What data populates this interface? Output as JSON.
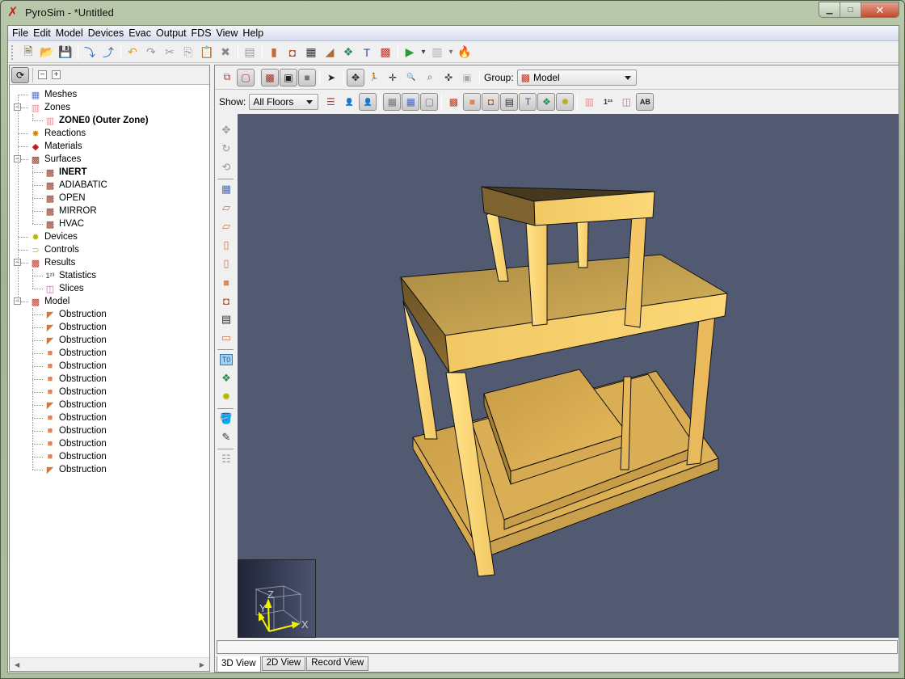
{
  "window": {
    "title": "PyroSim - *Untitled",
    "app_icon": "pyrosim-logo-icon",
    "controls": {
      "minimize": "▁",
      "maximize": "□",
      "close": "✕"
    }
  },
  "menubar": [
    "File",
    "Edit",
    "Model",
    "Devices",
    "Evac",
    "Output",
    "FDS",
    "View",
    "Help"
  ],
  "main_toolbar": [
    {
      "name": "new-file-icon",
      "glyph": "🗎",
      "color": "#6d5b2c"
    },
    {
      "name": "open-folder-icon",
      "glyph": "📂",
      "color": "#d79b2d"
    },
    {
      "name": "save-icon",
      "glyph": "💾",
      "color": "#5b7db6"
    },
    {
      "sep": true
    },
    {
      "name": "import-icon",
      "glyph": "⤵",
      "color": "#2b6dbf"
    },
    {
      "name": "export-icon",
      "glyph": "⤴",
      "color": "#2b6dbf"
    },
    {
      "sep": true
    },
    {
      "name": "undo-icon",
      "glyph": "↶",
      "color": "#d8a21d"
    },
    {
      "name": "redo-icon",
      "glyph": "↷",
      "color": "#999"
    },
    {
      "name": "cut-icon",
      "glyph": "✂",
      "color": "#999"
    },
    {
      "name": "copy-icon",
      "glyph": "⎘",
      "color": "#999"
    },
    {
      "name": "paste-icon",
      "glyph": "📋",
      "color": "#c79a4b"
    },
    {
      "name": "delete-icon",
      "glyph": "✖",
      "color": "#888"
    },
    {
      "sep": true
    },
    {
      "name": "edit-properties-icon",
      "glyph": "▤",
      "color": "#999"
    },
    {
      "sep": true
    },
    {
      "name": "new-obstruction-icon",
      "glyph": "▮",
      "color": "#c56a3a"
    },
    {
      "name": "new-hole-icon",
      "glyph": "◘",
      "color": "#a8552c"
    },
    {
      "name": "new-vent-icon",
      "glyph": "▦",
      "color": "#333"
    },
    {
      "name": "new-slope-icon",
      "glyph": "◢",
      "color": "#b06a39"
    },
    {
      "name": "new-device-icon",
      "glyph": "❖",
      "color": "#2e8b57"
    },
    {
      "name": "new-initial-condition-icon",
      "glyph": "T",
      "color": "#2a5a9a"
    },
    {
      "name": "new-group-icon",
      "glyph": "▩",
      "color": "#c0392b"
    },
    {
      "sep": true
    },
    {
      "name": "run-simulation-icon",
      "glyph": "▶",
      "color": "#2a9a3a"
    },
    {
      "name": "run-dropdown-icon",
      "glyph": "▾",
      "color": "#444"
    },
    {
      "name": "results-icon",
      "glyph": "▥",
      "color": "#aaa"
    },
    {
      "name": "results-dropdown-icon",
      "glyph": "▾",
      "color": "#777"
    },
    {
      "name": "fire-icon",
      "glyph": "🔥",
      "color": "#aaa"
    }
  ],
  "navigator": {
    "toggle_icon": "sync-navigation-icon",
    "collapse_all": "−",
    "expand_all": "+",
    "tree": [
      {
        "label": "Meshes",
        "level": 0,
        "icon": "mesh-icon",
        "glyph": "▦",
        "color": "#5b78c8"
      },
      {
        "label": "Zones",
        "level": 0,
        "icon": "zones-icon",
        "glyph": "▥",
        "color": "#e88a92",
        "expanded": true
      },
      {
        "label": "ZONE0 (Outer Zone)",
        "level": 1,
        "icon": "zone-icon",
        "glyph": "▥",
        "color": "#e88a92",
        "bold": true
      },
      {
        "label": "Reactions",
        "level": 0,
        "icon": "reactions-icon",
        "glyph": "✸",
        "color": "#d08a00"
      },
      {
        "label": "Materials",
        "level": 0,
        "icon": "materials-icon",
        "glyph": "◆",
        "color": "#c0201a"
      },
      {
        "label": "Surfaces",
        "level": 0,
        "icon": "surfaces-icon",
        "glyph": "▩",
        "color": "#8a3a2a",
        "expanded": true
      },
      {
        "label": "INERT",
        "level": 1,
        "icon": "surface-icon",
        "glyph": "▩",
        "color": "#8a3a2a",
        "bold": true
      },
      {
        "label": "ADIABATIC",
        "level": 1,
        "icon": "surface-icon",
        "glyph": "▩",
        "color": "#8a3a2a"
      },
      {
        "label": "OPEN",
        "level": 1,
        "icon": "surface-icon",
        "glyph": "▩",
        "color": "#8a3a2a"
      },
      {
        "label": "MIRROR",
        "level": 1,
        "icon": "surface-icon",
        "glyph": "▩",
        "color": "#8a3a2a"
      },
      {
        "label": "HVAC",
        "level": 1,
        "icon": "surface-icon",
        "glyph": "▩",
        "color": "#8a3a2a"
      },
      {
        "label": "Devices",
        "level": 0,
        "icon": "devices-icon",
        "glyph": "✹",
        "color": "#b5b500"
      },
      {
        "label": "Controls",
        "level": 0,
        "icon": "controls-icon",
        "glyph": "⊃",
        "color": "#c9a640"
      },
      {
        "label": "Results",
        "level": 0,
        "icon": "results-icon",
        "glyph": "▩",
        "color": "#c0392b",
        "expanded": true
      },
      {
        "label": "Statistics",
        "level": 1,
        "icon": "statistics-icon",
        "glyph": "1²³",
        "color": "#333"
      },
      {
        "label": "Slices",
        "level": 1,
        "icon": "slices-icon",
        "glyph": "◫",
        "color": "#c060a0"
      },
      {
        "label": "Model",
        "level": 0,
        "icon": "model-icon",
        "glyph": "▩",
        "color": "#c0392b",
        "expanded": true
      },
      {
        "label": "Obstruction",
        "level": 1,
        "icon": "slope-obstruction-icon",
        "glyph": "◤",
        "color": "#c97a4a"
      },
      {
        "label": "Obstruction",
        "level": 1,
        "icon": "slope-obstruction-icon",
        "glyph": "◤",
        "color": "#c97a4a"
      },
      {
        "label": "Obstruction",
        "level": 1,
        "icon": "slope-obstruction-icon",
        "glyph": "◤",
        "color": "#c97a4a"
      },
      {
        "label": "Obstruction",
        "level": 1,
        "icon": "box-obstruction-icon",
        "glyph": "■",
        "color": "#d9885a"
      },
      {
        "label": "Obstruction",
        "level": 1,
        "icon": "box-obstruction-icon",
        "glyph": "■",
        "color": "#d9885a"
      },
      {
        "label": "Obstruction",
        "level": 1,
        "icon": "box-obstruction-icon",
        "glyph": "■",
        "color": "#d9885a"
      },
      {
        "label": "Obstruction",
        "level": 1,
        "icon": "box-obstruction-icon",
        "glyph": "■",
        "color": "#d9885a"
      },
      {
        "label": "Obstruction",
        "level": 1,
        "icon": "slope-obstruction-icon",
        "glyph": "◤",
        "color": "#c97a4a"
      },
      {
        "label": "Obstruction",
        "level": 1,
        "icon": "box-obstruction-icon",
        "glyph": "■",
        "color": "#d9885a"
      },
      {
        "label": "Obstruction",
        "level": 1,
        "icon": "box-obstruction-icon",
        "glyph": "■",
        "color": "#d9885a"
      },
      {
        "label": "Obstruction",
        "level": 1,
        "icon": "box-obstruction-icon",
        "glyph": "■",
        "color": "#d9885a"
      },
      {
        "label": "Obstruction",
        "level": 1,
        "icon": "box-obstruction-icon",
        "glyph": "■",
        "color": "#d9885a"
      },
      {
        "label": "Obstruction",
        "level": 1,
        "icon": "slope-obstruction-icon",
        "glyph": "◤",
        "color": "#c97a4a"
      }
    ]
  },
  "view_toolbar": {
    "row1": [
      {
        "name": "wireframe-icon",
        "glyph": "⧉",
        "color": "#b03a2a"
      },
      {
        "name": "outline-icon",
        "glyph": "▢",
        "color": "#b03a2a",
        "on": true
      },
      {
        "sep": true
      },
      {
        "name": "texture-icon",
        "glyph": "▩",
        "color": "#a03020",
        "on": true
      },
      {
        "name": "solid-outline-icon",
        "glyph": "▣",
        "color": "#222",
        "on": true
      },
      {
        "name": "solid-icon",
        "glyph": "■",
        "color": "#777",
        "on": true
      },
      {
        "sep": true
      },
      {
        "name": "select-pointer-icon",
        "glyph": "➤",
        "color": "#222"
      },
      {
        "sep": true
      },
      {
        "name": "orbit-icon",
        "glyph": "✥",
        "color": "#222",
        "on": true
      },
      {
        "name": "walk-icon",
        "glyph": "🏃",
        "color": "#222"
      },
      {
        "name": "pan-icon",
        "glyph": "✛",
        "color": "#222"
      },
      {
        "name": "zoom-icon",
        "glyph": "🔍",
        "color": "#555"
      },
      {
        "name": "zoom-box-icon",
        "glyph": "⌕",
        "color": "#555"
      },
      {
        "name": "roam-icon",
        "glyph": "✜",
        "color": "#444"
      },
      {
        "name": "fit-icon",
        "glyph": "▣",
        "color": "#aaa"
      },
      {
        "sep": true
      }
    ],
    "group_label": "Group:",
    "group_value": "Model",
    "show_label": "Show:",
    "show_value": "All Floors",
    "row2": [
      {
        "name": "floor-levels-icon",
        "glyph": "☰",
        "color": "#c0392b"
      },
      {
        "name": "occupant-icon",
        "glyph": "👤",
        "color": "#2a7a2a"
      },
      {
        "name": "occupant-toggle-icon",
        "glyph": "👤",
        "color": "#2a7a2a",
        "on": true
      },
      {
        "sep": true
      },
      {
        "name": "show-grid-icon",
        "glyph": "▦",
        "color": "#777",
        "on": true
      },
      {
        "name": "show-mesh-icon",
        "glyph": "▦",
        "color": "#4a6cc8",
        "on": true
      },
      {
        "name": "show-mesh-outline-icon",
        "glyph": "▢",
        "color": "#777",
        "on": true
      },
      {
        "sep": true
      },
      {
        "name": "show-groups-icon",
        "glyph": "▩",
        "color": "#c0392b"
      },
      {
        "name": "show-obstructions-icon",
        "glyph": "■",
        "color": "#d9885a",
        "on": true
      },
      {
        "name": "show-holes-icon",
        "glyph": "◘",
        "color": "#a8552c",
        "on": true
      },
      {
        "name": "show-vents-icon",
        "glyph": "▤",
        "color": "#333",
        "on": true
      },
      {
        "name": "show-init-conditions-icon",
        "glyph": "T",
        "color": "#2a5a9a",
        "on": true
      },
      {
        "name": "show-devices-icon",
        "glyph": "❖",
        "color": "#2e8b57",
        "on": true
      },
      {
        "name": "show-sensors-icon",
        "glyph": "✹",
        "color": "#b5b500",
        "on": true
      },
      {
        "sep": true
      },
      {
        "name": "show-zones-icon",
        "glyph": "▥",
        "color": "#e88a92"
      },
      {
        "name": "show-statistics-icon",
        "glyph": "1²³",
        "color": "#333"
      },
      {
        "name": "show-slices-icon",
        "glyph": "◫",
        "color": "#c060a0"
      },
      {
        "name": "show-labels-icon",
        "glyph": "AB",
        "color": "#222",
        "on": true
      }
    ]
  },
  "side_tools": [
    {
      "name": "pan-view-icon",
      "glyph": "✥",
      "color": "#999"
    },
    {
      "name": "rotate-view-icon",
      "glyph": "↻",
      "color": "#999"
    },
    {
      "name": "reset-view-icon",
      "glyph": "⟲",
      "color": "#999"
    },
    {
      "sep": true
    },
    {
      "name": "draw-mesh-icon",
      "glyph": "▦",
      "color": "#4a6cc8"
    },
    {
      "name": "draw-slab-icon",
      "glyph": "▱",
      "color": "#c97a4a"
    },
    {
      "name": "draw-slab-hole-icon",
      "glyph": "▱",
      "color": "#c97a4a"
    },
    {
      "name": "draw-wall-icon",
      "glyph": "▯",
      "color": "#c97a4a"
    },
    {
      "name": "draw-wall-hole-icon",
      "glyph": "▯",
      "color": "#c97a4a"
    },
    {
      "name": "draw-block-icon",
      "glyph": "■",
      "color": "#d9885a"
    },
    {
      "name": "draw-hole-icon",
      "glyph": "◘",
      "color": "#a8552c"
    },
    {
      "name": "draw-vent-icon",
      "glyph": "▤",
      "color": "#333"
    },
    {
      "name": "draw-room-icon",
      "glyph": "▭",
      "color": "#c97a4a"
    },
    {
      "sep": true
    },
    {
      "name": "draw-initial-condition-icon",
      "glyph": "T0",
      "color": "#2a5a9a"
    },
    {
      "name": "draw-device-icon",
      "glyph": "❖",
      "color": "#2e8b57"
    },
    {
      "name": "draw-sprinkler-icon",
      "glyph": "✹",
      "color": "#b5b500"
    },
    {
      "sep": true
    },
    {
      "name": "paint-bucket-icon",
      "glyph": "🪣",
      "color": "#a03020"
    },
    {
      "name": "eyedropper-icon",
      "glyph": "✎",
      "color": "#333"
    },
    {
      "sep": true
    },
    {
      "name": "tool-options-icon",
      "glyph": "☷",
      "color": "#999"
    }
  ],
  "viewport": {
    "background": "#525a72",
    "axes": {
      "x": "X",
      "y": "Y",
      "z": "Z"
    }
  },
  "status_field": "",
  "view_tabs": [
    {
      "label": "3D View",
      "active": true
    },
    {
      "label": "2D View",
      "active": false
    },
    {
      "label": "Record View",
      "active": false
    }
  ]
}
